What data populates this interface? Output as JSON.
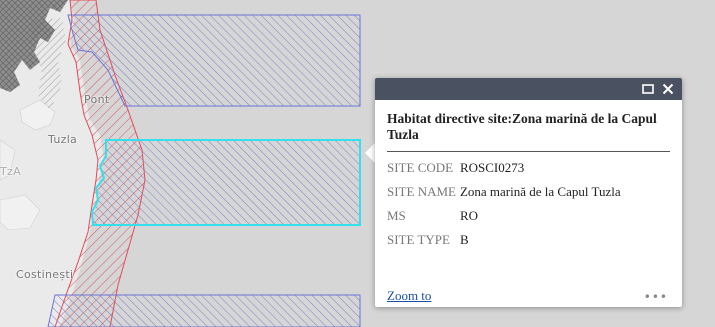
{
  "map": {
    "places": {
      "ponta": "Pont",
      "tuzla": "Tuzla",
      "tuza_left": "TzA",
      "costinesti": "Costinești"
    },
    "colors": {
      "land": "#e9e9e9",
      "sea": "#d4d4d4",
      "sci_boundary": "#e14b57",
      "spa_boundary": "#6c74d6",
      "selected": "#33e0ee",
      "urban": "#8f8f8f"
    }
  },
  "popup": {
    "title": "Habitat directive site:Zona marină de la Capul Tuzla",
    "attributes": [
      {
        "key": "SITE CODE",
        "value": "ROSCI0273"
      },
      {
        "key": "SITE NAME",
        "value": "Zona marină de la Capul Tuzla"
      },
      {
        "key": "MS",
        "value": "RO"
      },
      {
        "key": "SITE TYPE",
        "value": "B"
      }
    ],
    "zoom_label": "Zoom to",
    "more_label": "•••",
    "icons": [
      "maximize-icon",
      "close-icon"
    ]
  }
}
